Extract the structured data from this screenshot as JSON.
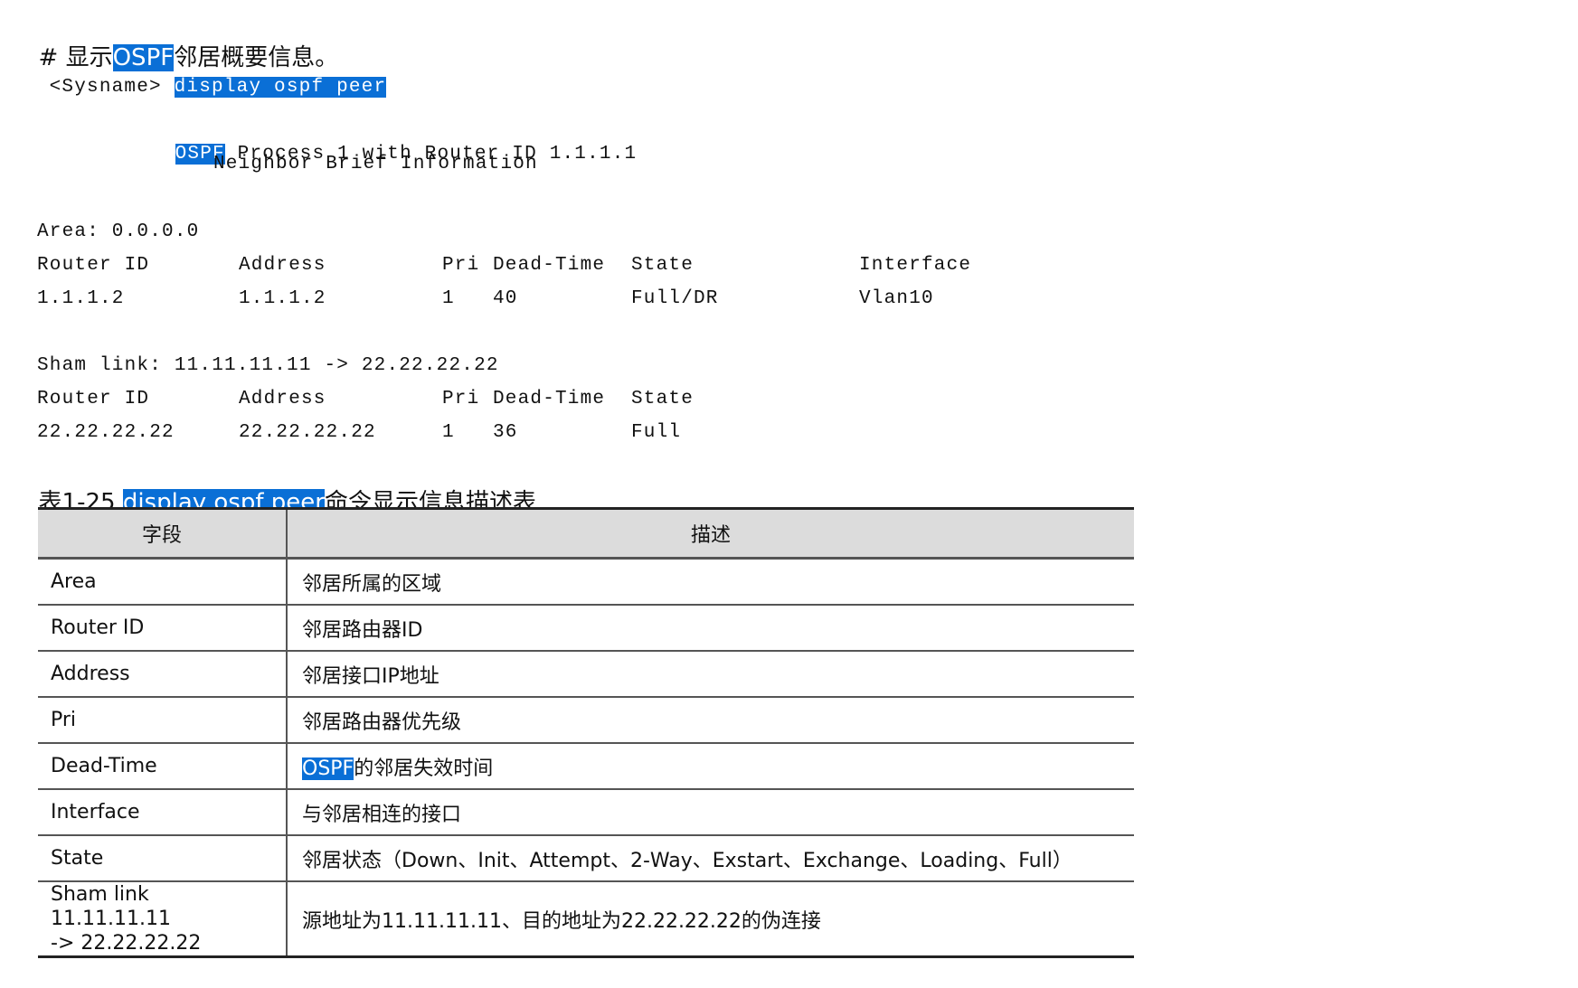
{
  "heading": {
    "prefix": "# 显示",
    "highlight": "OSPF",
    "suffix": "邻居概要信息。"
  },
  "command": {
    "prompt": "<Sysname>",
    "text": "display ospf peer"
  },
  "output": {
    "banner_tag": "OSPF",
    "banner_line1": "Process 1 with Router ID 1.1.1.1",
    "banner_line2": "Neighbor Brief Information",
    "area_line": "Area: 0.0.0.0",
    "area_headers": [
      "Router ID",
      "Address",
      "Pri",
      "Dead-Time",
      "State",
      "Interface"
    ],
    "area_row": [
      "1.1.1.2",
      "1.1.1.2",
      "1",
      "40",
      "Full/DR",
      "Vlan10"
    ],
    "sham_line": "Sham link: 11.11.11.11 -> 22.22.22.22",
    "sham_headers": [
      "Router ID",
      "Address",
      "Pri",
      "Dead-Time",
      "State"
    ],
    "sham_row": [
      "22.22.22.22",
      "22.22.22.22",
      "1",
      "36",
      "Full"
    ]
  },
  "caption": {
    "prefix": "表1-25 ",
    "highlight": "display ospf peer",
    "suffix": "命令显示信息描述表"
  },
  "table": {
    "headers": [
      "字段",
      "描述"
    ],
    "rows": [
      {
        "field": "Area",
        "desc": "邻居所属的区域"
      },
      {
        "field": "Router ID",
        "desc": "邻居路由器ID"
      },
      {
        "field": "Address",
        "desc": "邻居接口IP地址"
      },
      {
        "field": "Pri",
        "desc": "邻居路由器优先级"
      },
      {
        "field": "Dead-Time",
        "desc_highlight": "OSPF",
        "desc": "的邻居失效时间"
      },
      {
        "field": "Interface",
        "desc": "与邻居相连的接口"
      },
      {
        "field": "State",
        "desc": "邻居状态（Down、Init、Attempt、2-Way、Exstart、Exchange、Loading、Full）"
      },
      {
        "field_line1": "Sham link 11.11.11.11",
        "field_line2": "-> 22.22.22.22",
        "desc": "源地址为11.11.11.11、目的地址为22.22.22.22的伪连接"
      }
    ]
  },
  "colors": {
    "highlight": "#0a6fd6",
    "header_bg": "#dcdcdc"
  }
}
